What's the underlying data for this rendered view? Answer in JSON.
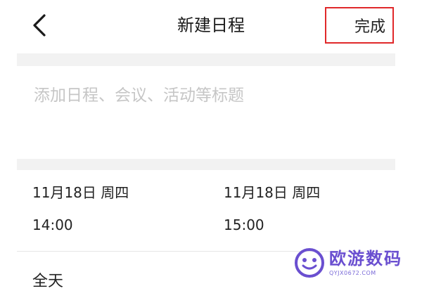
{
  "header": {
    "back_label": "<",
    "title": "新建日程",
    "done_label": "完成"
  },
  "title_field": {
    "placeholder": "添加日程、会议、活动等标题",
    "value": ""
  },
  "start": {
    "date": "11月18日 周四",
    "time": "14:00"
  },
  "end": {
    "date": "11月18日 周四",
    "time": "15:00"
  },
  "all_day": {
    "label": "全天"
  },
  "watermark": {
    "name": "欧游数码",
    "url": "QYJX0672.COM"
  },
  "colors": {
    "highlight_box": "#e0282a",
    "placeholder": "#c6c6c6",
    "band": "#f2f2f2",
    "watermark": "#6a4fd0"
  },
  "icons": {
    "back": "chevron-left-icon",
    "watermark_logo": "smiley-logo-icon"
  }
}
